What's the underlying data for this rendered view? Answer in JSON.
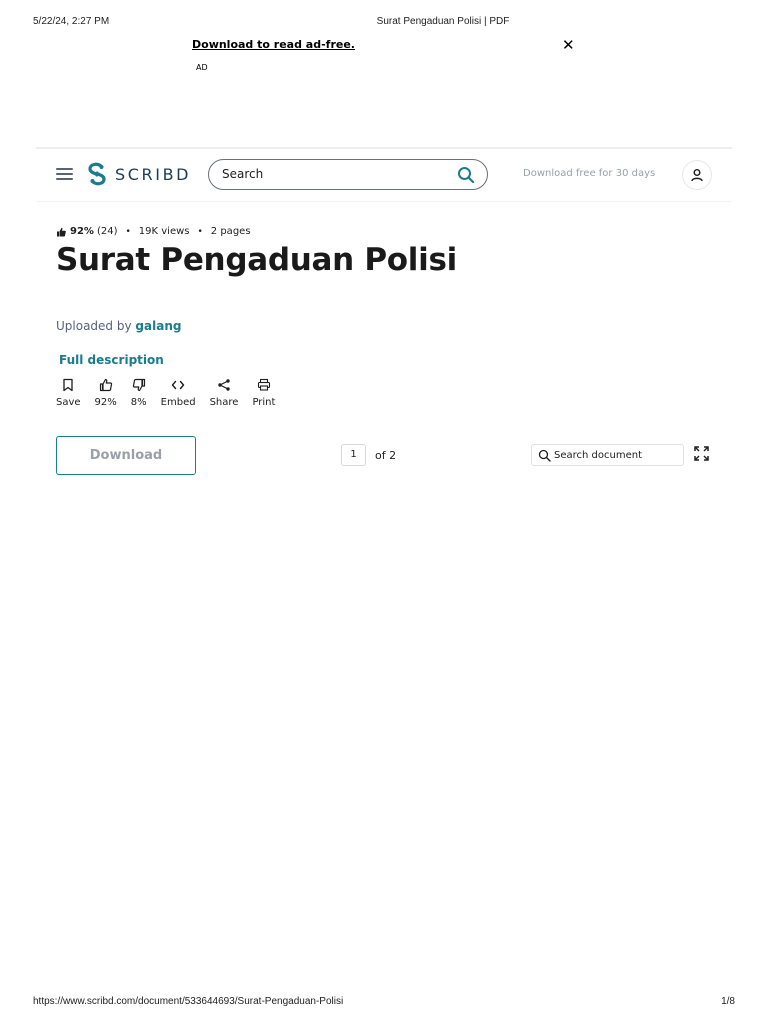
{
  "print_header": {
    "datetime": "5/22/24, 2:27 PM",
    "title": "Surat Pengaduan Polisi | PDF"
  },
  "ad": {
    "link_text": "Download to read ad-free.",
    "close": "✕",
    "label": "AD"
  },
  "topbar": {
    "menu_icon": "hamburger-icon",
    "logo_text": "SCRIBD",
    "search_placeholder": "Search",
    "search_icon": "search-icon",
    "download_free": "Download free for 30 days",
    "user_icon": "user-icon"
  },
  "document": {
    "rating": "92%",
    "rating_count": "(24)",
    "views": "19K views",
    "pages": "2 pages",
    "title": "Surat Pengaduan Polisi",
    "uploaded_by_label": "Uploaded by",
    "uploader": "galang",
    "full_description": "Full description"
  },
  "actions": [
    {
      "icon": "bookmark-icon",
      "label": "Save"
    },
    {
      "icon": "thumbs-up-icon",
      "label": "92%"
    },
    {
      "icon": "thumbs-down-icon",
      "label": "8%"
    },
    {
      "icon": "code-icon",
      "label": "Embed"
    },
    {
      "icon": "share-icon",
      "label": "Share"
    },
    {
      "icon": "print-icon",
      "label": "Print"
    }
  ],
  "viewer": {
    "download_label": "Download",
    "page_current": "1",
    "page_of": "of 2",
    "search_placeholder": "Search document",
    "fullscreen_icon": "fullscreen-icon"
  },
  "print_footer": {
    "url": "https://www.scribd.com/document/533644693/Surat-Pengaduan-Polisi",
    "page": "1/8"
  },
  "colors": {
    "brand": "#1e3c52",
    "accent": "#1b7c8c",
    "muted": "#9aa0a8"
  }
}
